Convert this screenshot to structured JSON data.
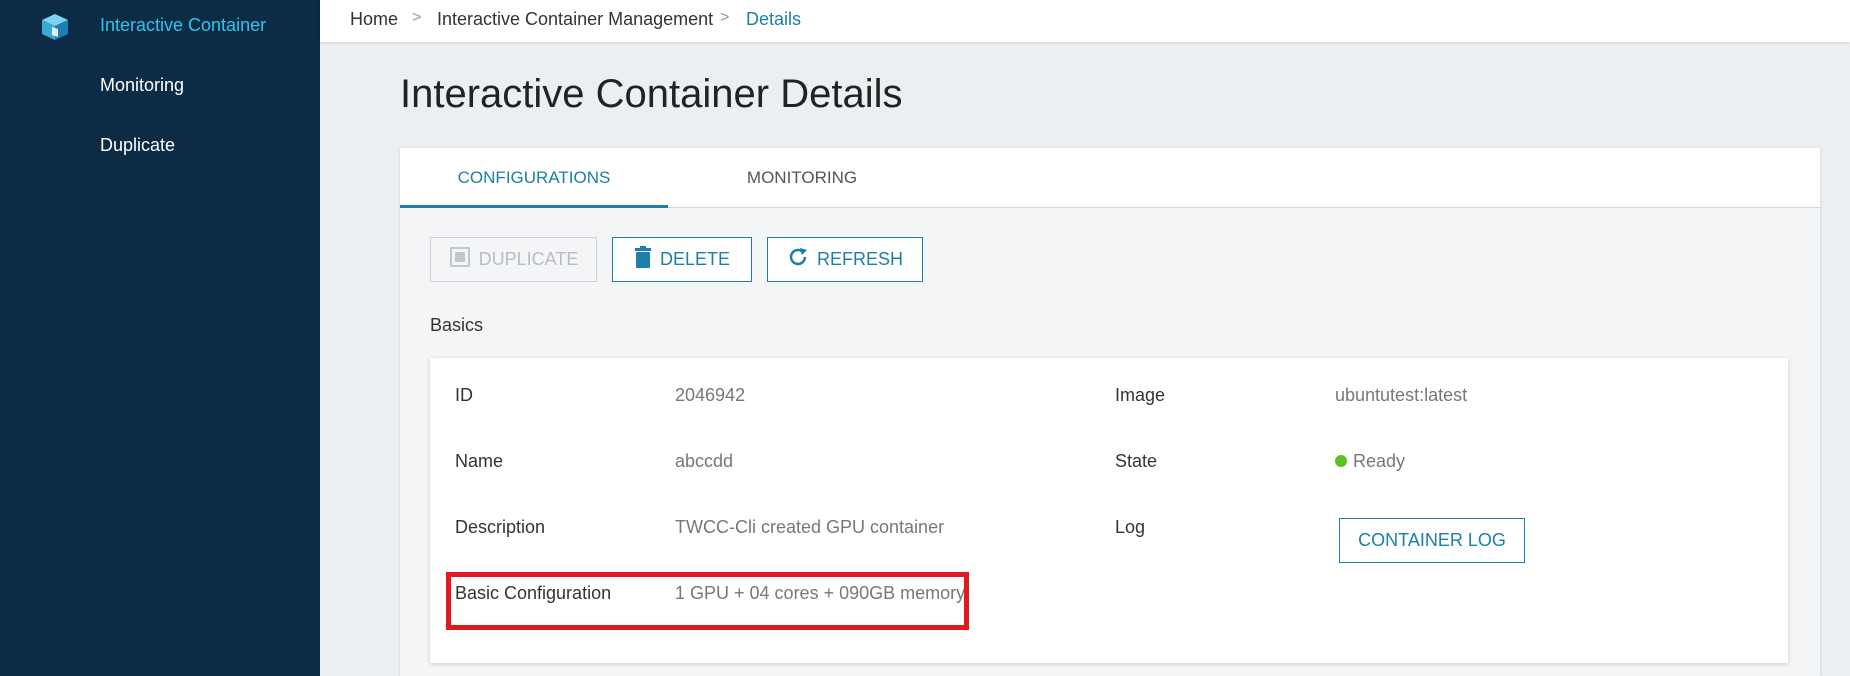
{
  "sidebar": {
    "items": [
      {
        "label": "Interactive Container"
      },
      {
        "label": "Monitoring"
      },
      {
        "label": "Duplicate"
      }
    ],
    "logo_icon": "cube-icon"
  },
  "breadcrumb": {
    "items": [
      "Home",
      "Interactive Container Management",
      "Details"
    ],
    "separator": ">"
  },
  "page": {
    "title": "Interactive Container Details"
  },
  "tabs": [
    {
      "label": "CONFIGURATIONS",
      "active": true
    },
    {
      "label": "MONITORING",
      "active": false
    }
  ],
  "toolbar": {
    "duplicate_label": "DUPLICATE",
    "delete_label": "DELETE",
    "refresh_label": "REFRESH"
  },
  "basics": {
    "section_label": "Basics",
    "id_label": "ID",
    "id_value": "2046942",
    "name_label": "Name",
    "name_value": "abccdd",
    "description_label": "Description",
    "description_value": "TWCC-Cli created GPU container",
    "basic_config_label": "Basic Configuration",
    "basic_config_value": "1 GPU + 04 cores + 090GB memory",
    "image_label": "Image",
    "image_value": "ubuntutest:latest",
    "state_label": "State",
    "state_value": "Ready",
    "log_label": "Log",
    "log_button_label": "CONTAINER LOG"
  },
  "colors": {
    "sidebar_bg": "#0c2b44",
    "accent": "#1b7fa6",
    "active_nav": "#2fc6e9",
    "status_ready": "#58c322",
    "highlight": "#e0191f"
  }
}
